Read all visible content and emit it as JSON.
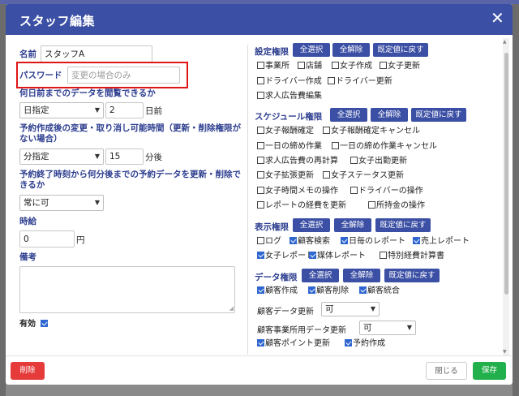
{
  "dialog": {
    "title": "スタッフ編集",
    "close_symbol": "✕"
  },
  "left": {
    "name_label": "名前",
    "name_value": "スタッフA",
    "password_label": "パスワード",
    "password_placeholder": "変更の場合のみ",
    "browse_label": "何日前までのデータを閲覧できるか",
    "browse_select": "日指定",
    "browse_days": "2",
    "browse_unit": "日前",
    "cancel_change_label": "予約作成後の変更・取り消し可能時間（更新・削除権限がない場合）",
    "cancel_select": "分指定",
    "cancel_minutes": "15",
    "cancel_unit": "分後",
    "after_end_label": "予約終了時刻から何分後までの予約データを更新・削除できるか",
    "after_end_select": "常に可",
    "hourly_label": "時給",
    "hourly_value": "0",
    "hourly_unit": "円",
    "notes_label": "備考",
    "active_label": "有効",
    "active_checked": true
  },
  "buttons": {
    "select_all": "全選択",
    "clear_all": "全解除",
    "reset_default": "既定値に戻す"
  },
  "sections": {
    "settings": {
      "title": "設定権限",
      "items": [
        {
          "label": "事業所",
          "checked": false
        },
        {
          "label": "店舗",
          "checked": false
        },
        {
          "label": "女子作成",
          "checked": false
        },
        {
          "label": "女子更新",
          "checked": false
        },
        {
          "label": "ドライバー作成",
          "checked": false
        },
        {
          "label": "ドライバー更新",
          "checked": false
        },
        {
          "label": "求人広告費編集",
          "checked": false
        }
      ]
    },
    "schedule": {
      "title": "スケジュール権限",
      "items": [
        {
          "label": "女子報酬確定",
          "checked": false
        },
        {
          "label": "女子報酬確定キャンセル",
          "checked": false
        },
        {
          "label": "一日の締め作業",
          "checked": false
        },
        {
          "label": "一日の締め作業キャンセル",
          "checked": false
        },
        {
          "label": "求人広告費の再計算",
          "checked": false
        },
        {
          "label": "女子出勤更新",
          "checked": false
        },
        {
          "label": "女子拡張更新",
          "checked": false
        },
        {
          "label": "女子ステータス更新",
          "checked": false
        },
        {
          "label": "女子時間メモの操作",
          "checked": false
        },
        {
          "label": "ドライバーの操作",
          "checked": false
        },
        {
          "label": "レポートの経費を更新",
          "checked": false
        },
        {
          "label": "所持金の操作",
          "checked": false
        }
      ]
    },
    "display": {
      "title": "表示権限",
      "items": [
        {
          "label": "ログ",
          "checked": false
        },
        {
          "label": "顧客検索",
          "checked": true
        },
        {
          "label": "日毎のレポート",
          "checked": true
        },
        {
          "label": "売上レポート",
          "checked": true
        },
        {
          "label": "女子レポート",
          "checked": true
        },
        {
          "label": "媒体レポート",
          "checked": true
        },
        {
          "label": "特別経費計算書",
          "checked": false
        }
      ]
    },
    "data": {
      "title": "データ権限",
      "items": [
        {
          "label": "顧客作成",
          "checked": true
        },
        {
          "label": "顧客削除",
          "checked": true
        },
        {
          "label": "顧客統合",
          "checked": true
        },
        {
          "label": "顧客ポイント更新",
          "checked": true
        },
        {
          "label": "予約作成",
          "checked": true
        }
      ],
      "customer_update_label": "顧客データ更新",
      "customer_update_value": "可",
      "office_update_label": "顧客事業所用データ更新",
      "office_update_value": "可"
    }
  },
  "footer": {
    "delete": "削除",
    "close": "閉じる",
    "save": "保存"
  }
}
